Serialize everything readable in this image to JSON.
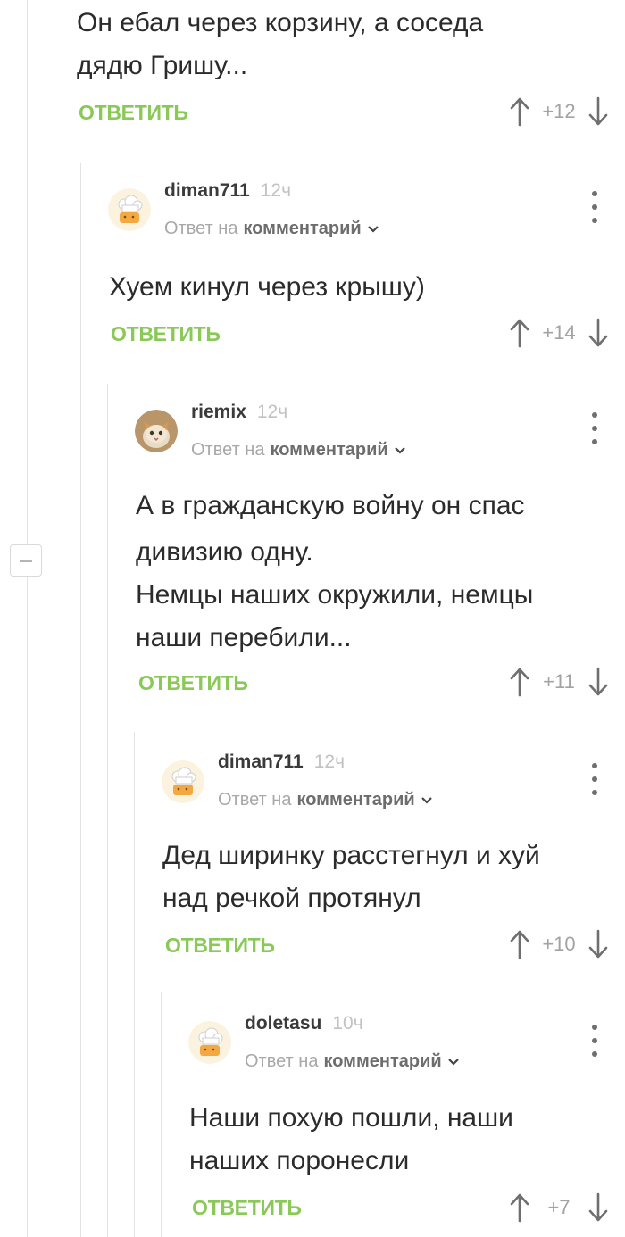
{
  "ui": {
    "accent_color": "#8ac858",
    "reply_label": "ОТВЕТИТЬ",
    "reply_to_prefix": "Ответ на",
    "reply_to_target": "комментарий"
  },
  "top_comment": {
    "lines": [
      "Он ебал через корзину, а соседа",
      "дядю Гришу..."
    ],
    "score": "+12"
  },
  "comments": [
    {
      "author": "diman711",
      "time": "12ч",
      "avatar": "chef-hat-avatar",
      "lines": [
        "Хуем кинул через крышу)"
      ],
      "score": "+14"
    },
    {
      "author": "riemix",
      "time": "12ч",
      "avatar": "cat-photo-avatar",
      "lines": [
        "А в гражданскую войну он спас",
        "дивизию одну.",
        "Немцы наших окружили, немцы",
        "наши перебили..."
      ],
      "score": "+11"
    },
    {
      "author": "diman711",
      "time": "12ч",
      "avatar": "chef-hat-avatar",
      "lines": [
        "Дед ширинку расстегнул и хуй",
        "над речкой протянул"
      ],
      "score": "+10"
    },
    {
      "author": "doletasu",
      "time": "10ч",
      "avatar": "chef-hat-avatar",
      "lines": [
        "Наши похую пошли, наши",
        "наших поронесли"
      ],
      "score": "+7"
    }
  ]
}
